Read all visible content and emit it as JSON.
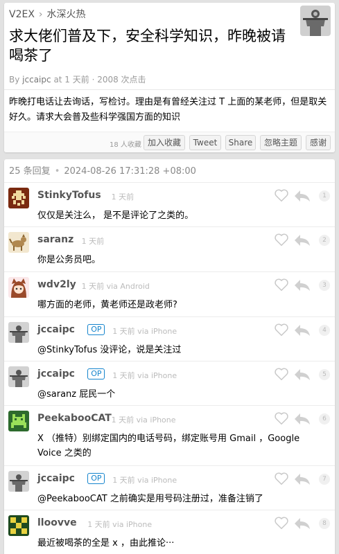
{
  "breadcrumb": {
    "site": "V2EX",
    "separator": "›",
    "node": "水深火热"
  },
  "topic": {
    "title": "求大佬们普及下，安全科学知识，昨晚被请喝茶了",
    "by": "By",
    "author": "jccaipc",
    "meta": "at 1 天前 · 2008 次点击",
    "content": "昨晚打电话让去询话，写检讨。理由是有曾经关注过 T 上面的某老师，但是取关好久。请求大会普及些科学强国方面的知识",
    "favorites": "18 人收藏",
    "buttons": [
      "加入收藏",
      "Tweet",
      "Share",
      "忽略主题",
      "感谢"
    ]
  },
  "replies_header": {
    "count": "25 条回复",
    "separator": "•",
    "timestamp": "2024-08-26 17:31:28 +08:00"
  },
  "colors": {
    "op_badge": "#1484cd",
    "bg": "#e2e2e2"
  },
  "replies": [
    {
      "user": "StinkyTofus",
      "op": "",
      "time": "1 天前",
      "text": "仅仅是关注么， 是不是评论了之类的。",
      "no": "1",
      "avatar": "pixel-invader-icon"
    },
    {
      "user": "saranz",
      "op": "",
      "time": "1 天前",
      "text": "你是公务员吧。",
      "no": "2",
      "avatar": "animal-icon"
    },
    {
      "user": "wdv2ly",
      "op": "",
      "time": "1 天前 via Android",
      "text": "哪方面的老师，黄老师还是政老师?",
      "no": "3",
      "avatar": "anime-girl-icon"
    },
    {
      "user": "jccaipc",
      "op": "OP",
      "time": "1 天前 via iPhone",
      "text": "@StinkyTofus 没评论，说是关注过",
      "no": "4",
      "avatar": "person-icon"
    },
    {
      "user": "jccaipc",
      "op": "OP",
      "time": "1 天前 via iPhone",
      "text": "@saranz 屁民一个",
      "no": "5",
      "avatar": "person-icon"
    },
    {
      "user": "PeekabooCAT",
      "op": "",
      "time": "1 天前 via iPhone",
      "text": "X （推特）别绑定国内的电话号码，绑定账号用 Gmail ，Google Voice 之类的",
      "no": "6",
      "avatar": "pixel-cat-icon"
    },
    {
      "user": "jccaipc",
      "op": "OP",
      "time": "1 天前 via iPhone",
      "text": "@PeekabooCAT 之前确实是用号码注册过，准备注销了",
      "no": "7",
      "avatar": "person-icon"
    },
    {
      "user": "lloovve",
      "op": "",
      "time": "1 天前 via iPhone",
      "text": "最近被喝茶的全是 x ，由此推论···",
      "no": "8",
      "avatar": "pixel-pattern-icon"
    }
  ]
}
